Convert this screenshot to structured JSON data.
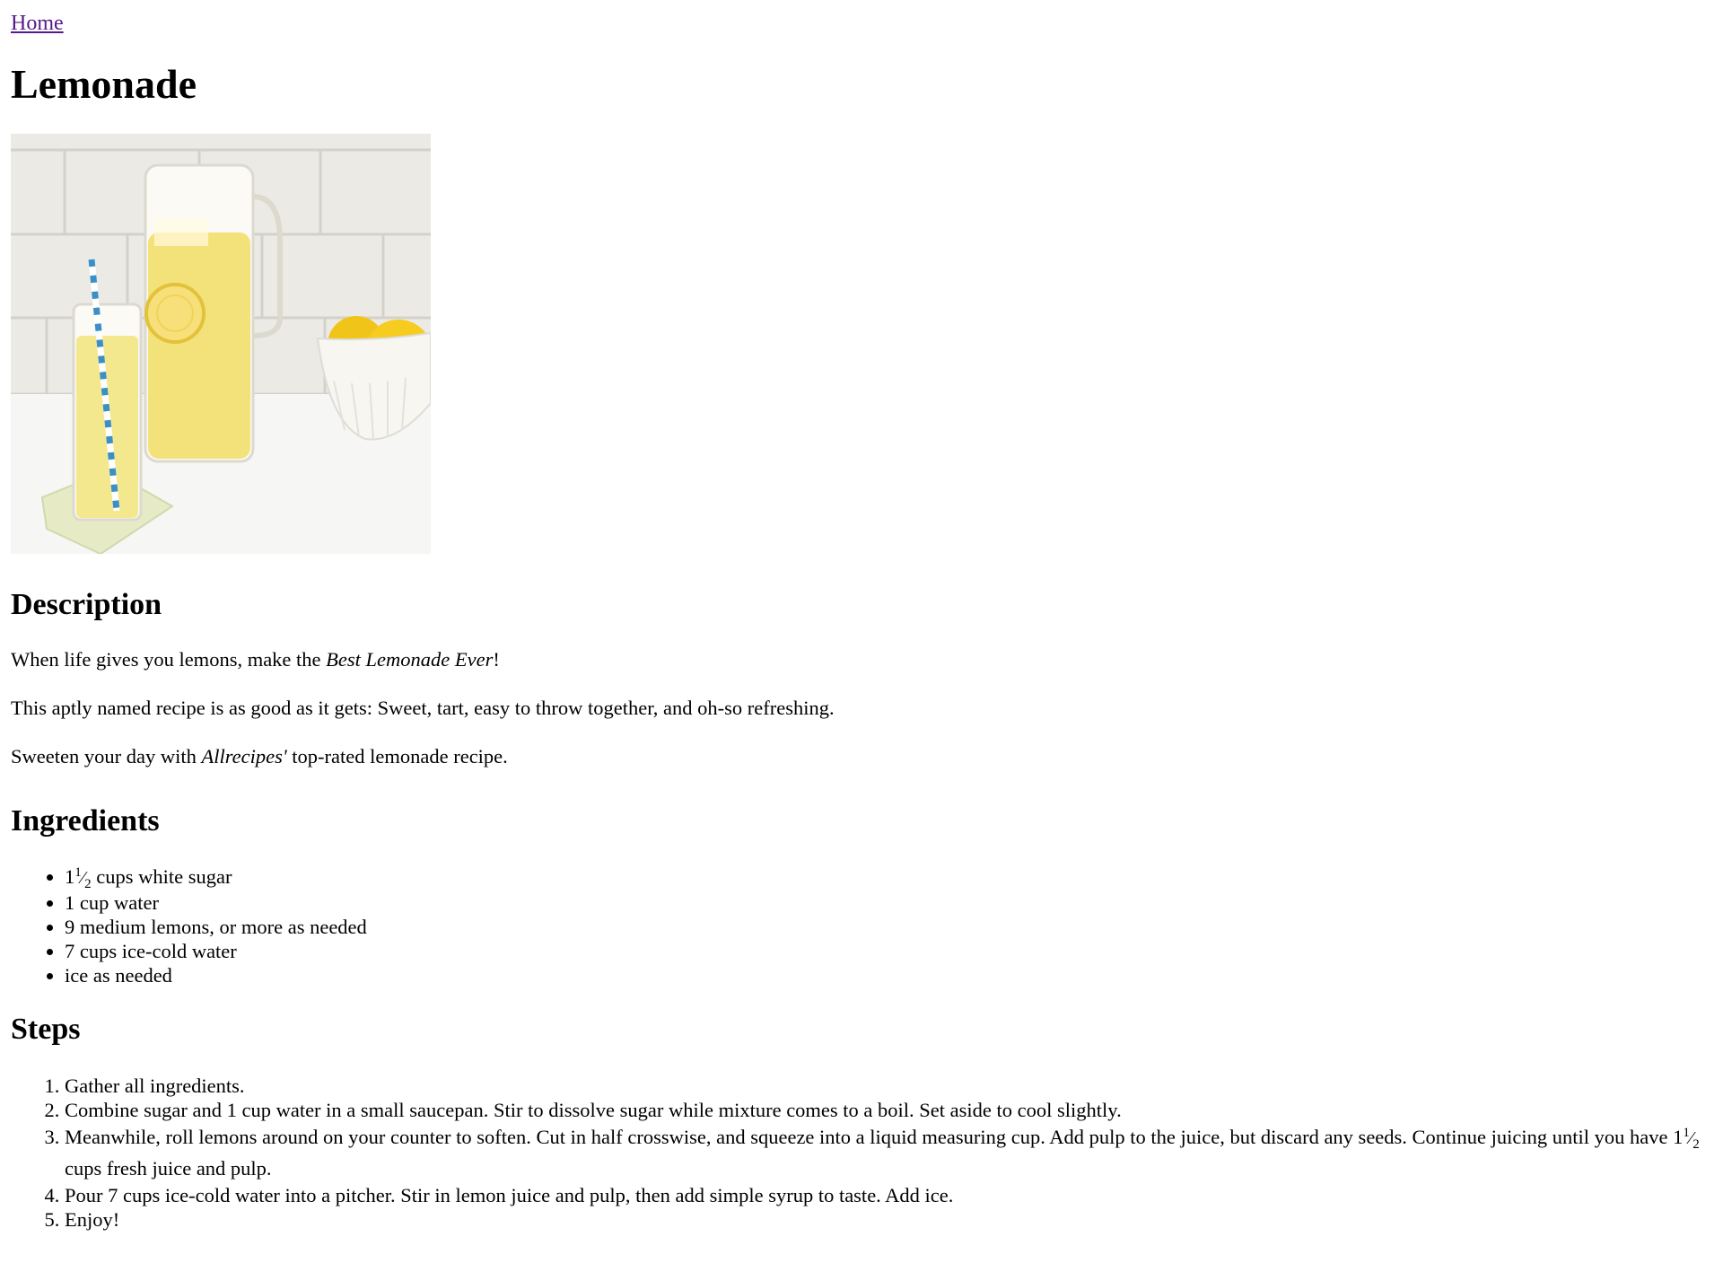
{
  "nav": {
    "home_label": "Home"
  },
  "recipe": {
    "title": "Lemonade",
    "description": {
      "heading": "Description",
      "p1_before": "When life gives you lemons, make the ",
      "p1_em": "Best Lemonade Ever",
      "p1_after": "!",
      "p2": "This aptly named recipe is as good as it gets: Sweet, tart, easy to throw together, and oh-so refreshing.",
      "p3_before": "Sweeten your day with ",
      "p3_em": "Allrecipes'",
      "p3_after": " top-rated lemonade recipe."
    },
    "ingredients": {
      "heading": "Ingredients",
      "item1_whole": "1",
      "item1_num": "1",
      "item1_slash": "⁄",
      "item1_den": "2",
      "item1_text": " cups white sugar",
      "items": [
        "1 cup water",
        "9 medium lemons, or more as needed",
        "7 cups ice-cold water",
        "ice as needed"
      ]
    },
    "steps": {
      "heading": "Steps",
      "s1": "Gather all ingredients.",
      "s2": "Combine sugar and 1 cup water in a small saucepan. Stir to dissolve sugar while mixture comes to a boil. Set aside to cool slightly.",
      "s3_before": "Meanwhile, roll lemons around on your counter to soften. Cut in half crosswise, and squeeze into a liquid measuring cup. Add pulp to the juice, but discard any seeds. Continue juicing until you have ",
      "s3_whole": "1",
      "s3_num": "1",
      "s3_slash": "⁄",
      "s3_den": "2",
      "s3_after": " cups fresh juice and pulp.",
      "s4": "Pour 7 cups ice-cold water into a pitcher. Stir in lemon juice and pulp, then add simple syrup to taste. Add ice.",
      "s5": "Enjoy!"
    }
  },
  "colors": {
    "link_visited": "#551a8b",
    "lemonade": "#f3e27a",
    "lemon": "#f0c419"
  }
}
